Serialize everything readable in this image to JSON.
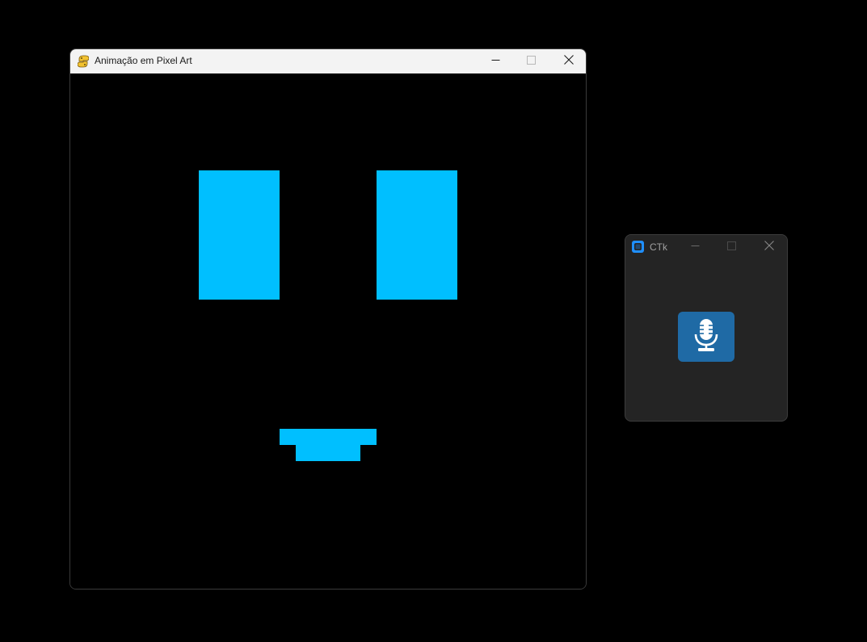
{
  "pygame_window": {
    "title": "Animação em Pixel Art",
    "icon": "pygame-snake-icon",
    "controls": {
      "minimize": "minimize-icon",
      "maximize": "maximize-icon",
      "close": "close-icon"
    },
    "canvas": {
      "background": "#000000",
      "pixel_color": "#00bfff"
    }
  },
  "ctk_window": {
    "title": "CTk",
    "icon": "ctk-app-icon",
    "controls": {
      "minimize": "minimize-icon",
      "maximize": "maximize-icon",
      "close": "close-icon"
    },
    "button": {
      "icon": "microphone-icon",
      "color": "#1f6aa5"
    },
    "background": "#242424"
  }
}
